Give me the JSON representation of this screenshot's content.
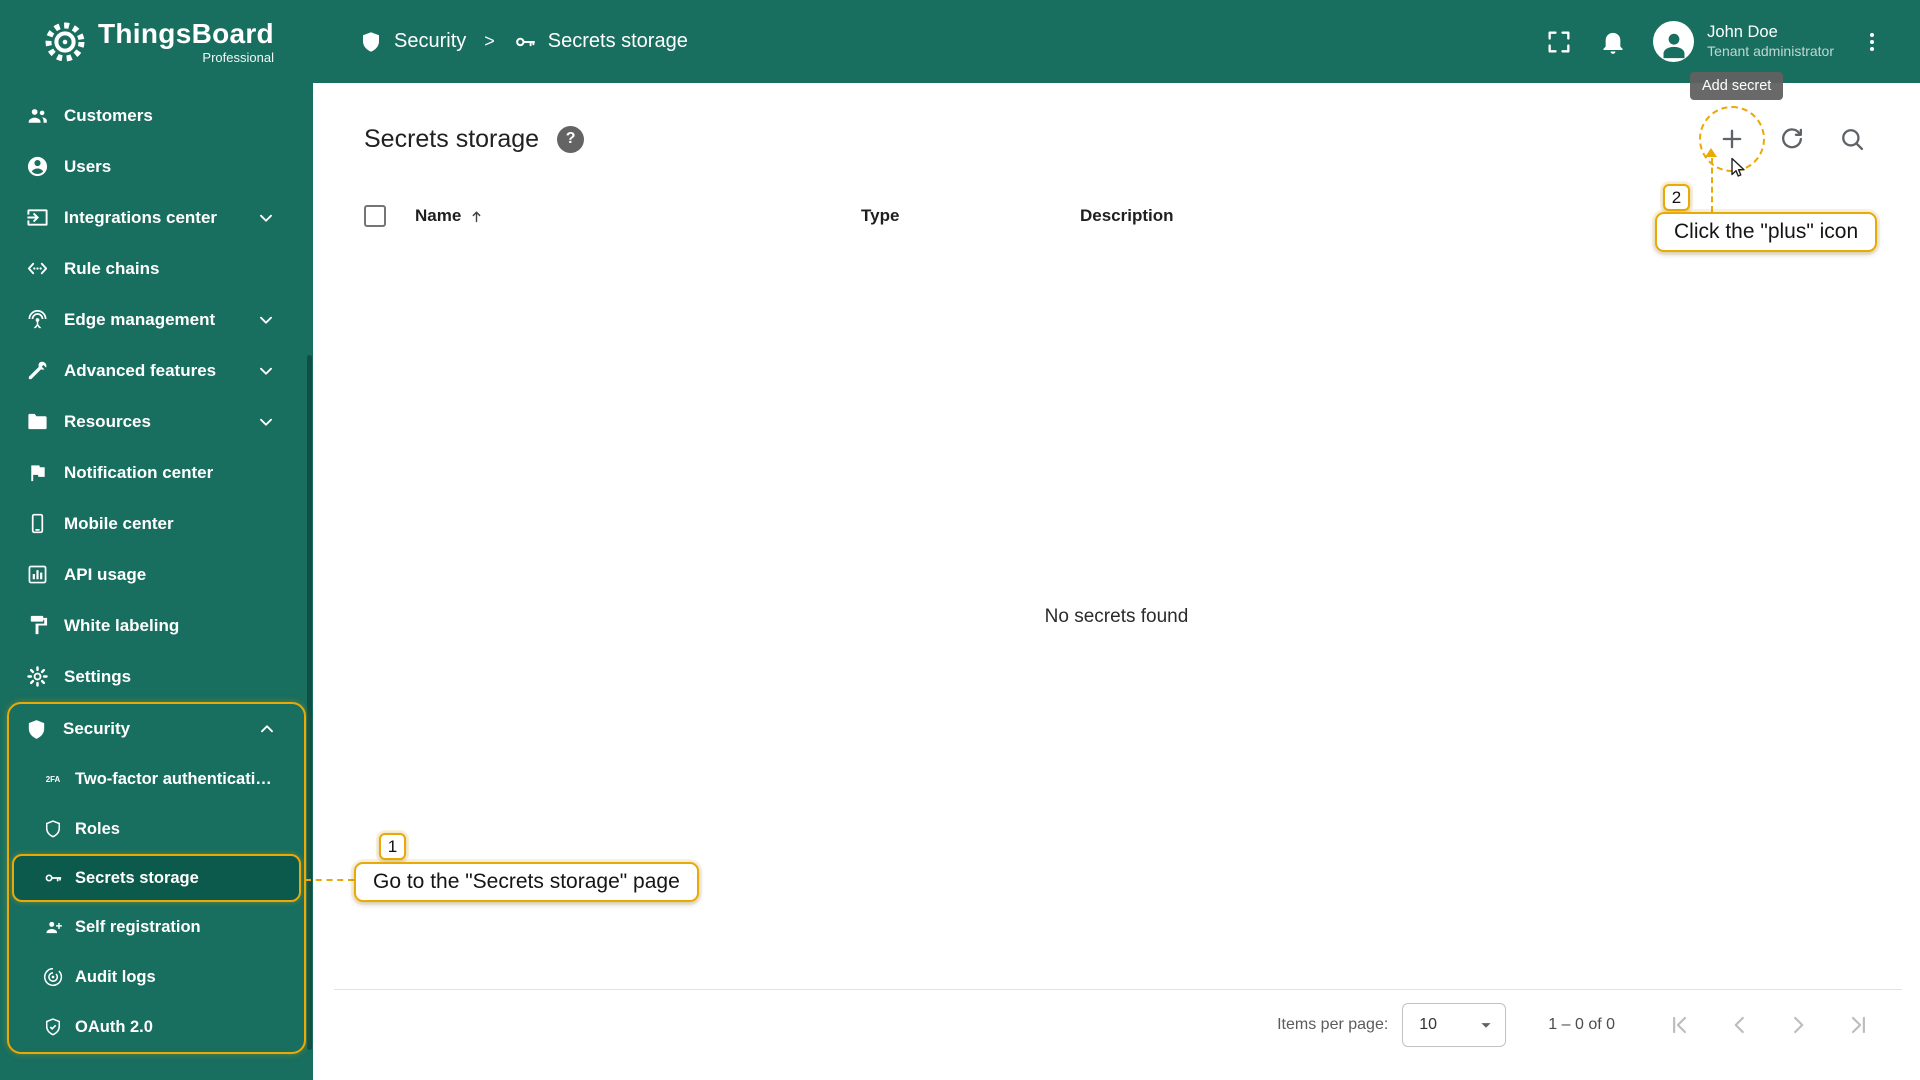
{
  "colors": {
    "primary": "#186e5f",
    "primary_active": "#0c5a4c",
    "annotation_gold": "#e9a906",
    "tooltip_bg": "#616161"
  },
  "brand": {
    "name": "ThingsBoard",
    "subtitle": "Professional",
    "logo_icon": "thingsboard-logo-icon"
  },
  "breadcrumb": {
    "separator": ">",
    "items": [
      {
        "label": "Security",
        "icon": "shield-icon"
      },
      {
        "label": "Secrets storage",
        "icon": "key-icon"
      }
    ]
  },
  "topbar": {
    "icons": [
      "fullscreen-icon",
      "notifications-bell-icon",
      "kebab-menu-icon"
    ],
    "user": {
      "name": "John Doe",
      "role": "Tenant administrator",
      "avatar_icon": "avatar-person-icon"
    },
    "tooltip": {
      "text": "Add secret"
    }
  },
  "sidebar": {
    "items": [
      {
        "label": "Customers",
        "icon": "people-icon"
      },
      {
        "label": "Users",
        "icon": "person-icon"
      },
      {
        "label": "Integrations center",
        "icon": "integrations-icon",
        "expandable": true
      },
      {
        "label": "Rule chains",
        "icon": "rule-chains-icon"
      },
      {
        "label": "Edge management",
        "icon": "antenna-icon",
        "expandable": true
      },
      {
        "label": "Advanced features",
        "icon": "tools-icon",
        "expandable": true
      },
      {
        "label": "Resources",
        "icon": "folder-icon",
        "expandable": true
      },
      {
        "label": "Notification center",
        "icon": "flag-icon"
      },
      {
        "label": "Mobile center",
        "icon": "smartphone-icon"
      },
      {
        "label": "API usage",
        "icon": "chart-icon"
      },
      {
        "label": "White labeling",
        "icon": "paint-icon"
      },
      {
        "label": "Settings",
        "icon": "gear-icon"
      },
      {
        "label": "Security",
        "icon": "shield-icon",
        "expandable": true,
        "expanded": true,
        "children": [
          {
            "label": "Two-factor authenticati…",
            "icon": "2fa-icon",
            "icon_glyph": "2FA"
          },
          {
            "label": "Roles",
            "icon": "roles-shield-icon"
          },
          {
            "label": "Secrets storage",
            "icon": "key-icon",
            "active": true
          },
          {
            "label": "Self registration",
            "icon": "person-add-icon"
          },
          {
            "label": "Audit logs",
            "icon": "audit-target-icon"
          },
          {
            "label": "OAuth 2.0",
            "icon": "oauth-shield-icon"
          }
        ]
      }
    ]
  },
  "main": {
    "title": "Secrets storage",
    "help_glyph": "?",
    "toolbar": [
      {
        "name": "add-button",
        "icon": "plus-icon"
      },
      {
        "name": "refresh-button",
        "icon": "refresh-icon"
      },
      {
        "name": "search-button",
        "icon": "search-icon"
      }
    ],
    "table": {
      "columns": [
        {
          "label": "Name",
          "sorted": "asc"
        },
        {
          "label": "Type"
        },
        {
          "label": "Description"
        }
      ],
      "empty_text": "No secrets found"
    },
    "paginator": {
      "items_per_page_label": "Items per page:",
      "page_size": "10",
      "range": "1 – 0 of 0"
    }
  },
  "annotations": {
    "step1": {
      "number": "1",
      "text": "Go to the \"Secrets storage\" page"
    },
    "step2": {
      "number": "2",
      "text": "Click the \"plus\" icon"
    }
  }
}
